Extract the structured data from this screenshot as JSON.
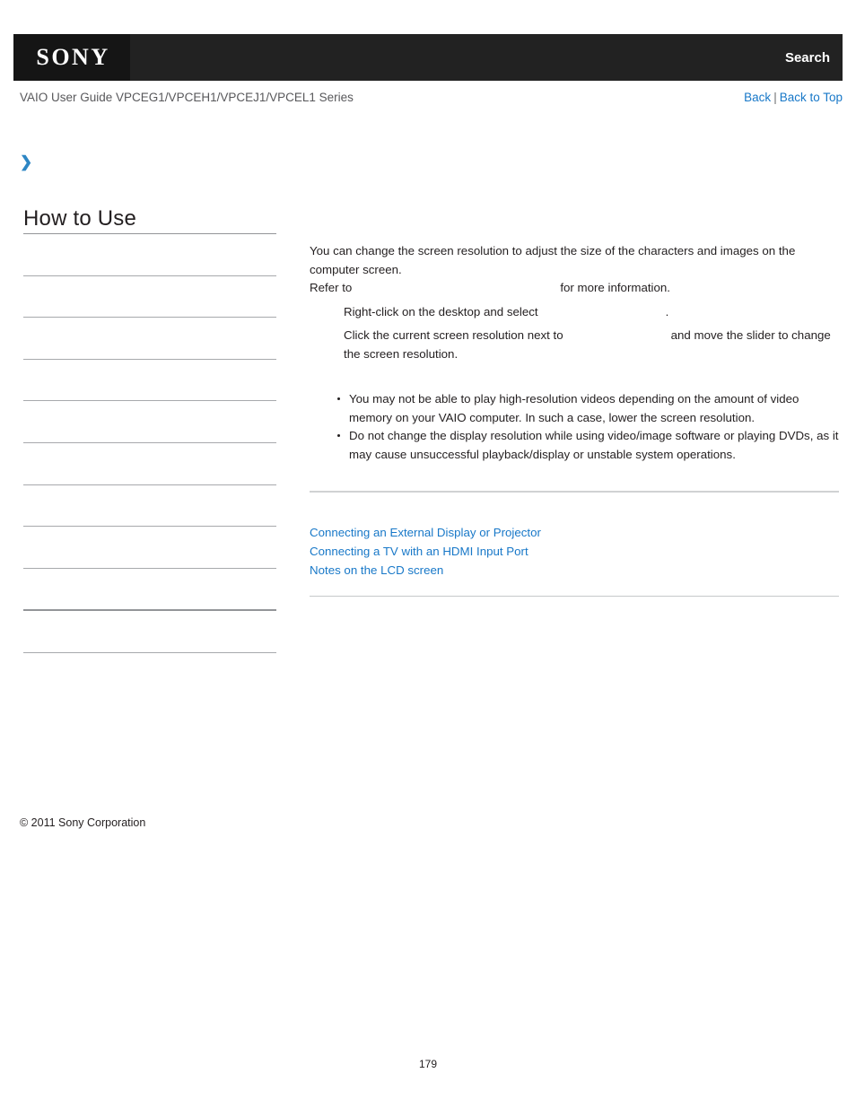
{
  "header": {
    "logo_text": "SONY",
    "search_label": "Search",
    "logo_icon": "sony-logo",
    "background_color": "#222222",
    "logo_block_color": "#151515"
  },
  "subheader": {
    "guide_title": "VAIO User Guide VPCEG1/VPCEH1/VPCEJ1/VPCEL1 Series",
    "back_label": "Back",
    "separator": "|",
    "back_to_top_label": "Back to Top",
    "link_color": "#1878c8"
  },
  "sidebar": {
    "breadcrumb_icon": "chevron-right-icon",
    "breadcrumb_text": "",
    "title": "How to Use",
    "items": [
      {
        "label": ""
      },
      {
        "label": ""
      },
      {
        "label": ""
      },
      {
        "label": ""
      },
      {
        "label": ""
      },
      {
        "label": ""
      },
      {
        "label": ""
      },
      {
        "label": ""
      },
      {
        "label": ""
      },
      {
        "label": ""
      },
      {
        "label": ""
      }
    ],
    "copyright": "© 2011 Sony Corporation"
  },
  "main": {
    "intro_line1": "You can change the screen resolution to adjust the size of the characters and images on the",
    "intro_line2": "computer screen.",
    "refer_prefix": "Refer to",
    "refer_suffix": "for more information.",
    "steps": [
      {
        "text_before": "Right-click on the desktop and select",
        "text_after": "."
      },
      {
        "text_before": "Click the current screen resolution next to",
        "text_after": "and move the slider to change",
        "text_line2": "the screen resolution."
      }
    ],
    "notes": [
      "You may not be able to play high-resolution videos depending on the amount of video memory on your VAIO computer. In such a case, lower the screen resolution.",
      "Do not change the display resolution while using video/image software or playing DVDs, as it may cause unsuccessful playback/display or unstable system operations."
    ],
    "related_links": [
      "Connecting an External Display or Projector",
      "Connecting a TV with an HDMI Input Port",
      "Notes on the LCD screen"
    ]
  },
  "footer": {
    "page_number": "179"
  }
}
